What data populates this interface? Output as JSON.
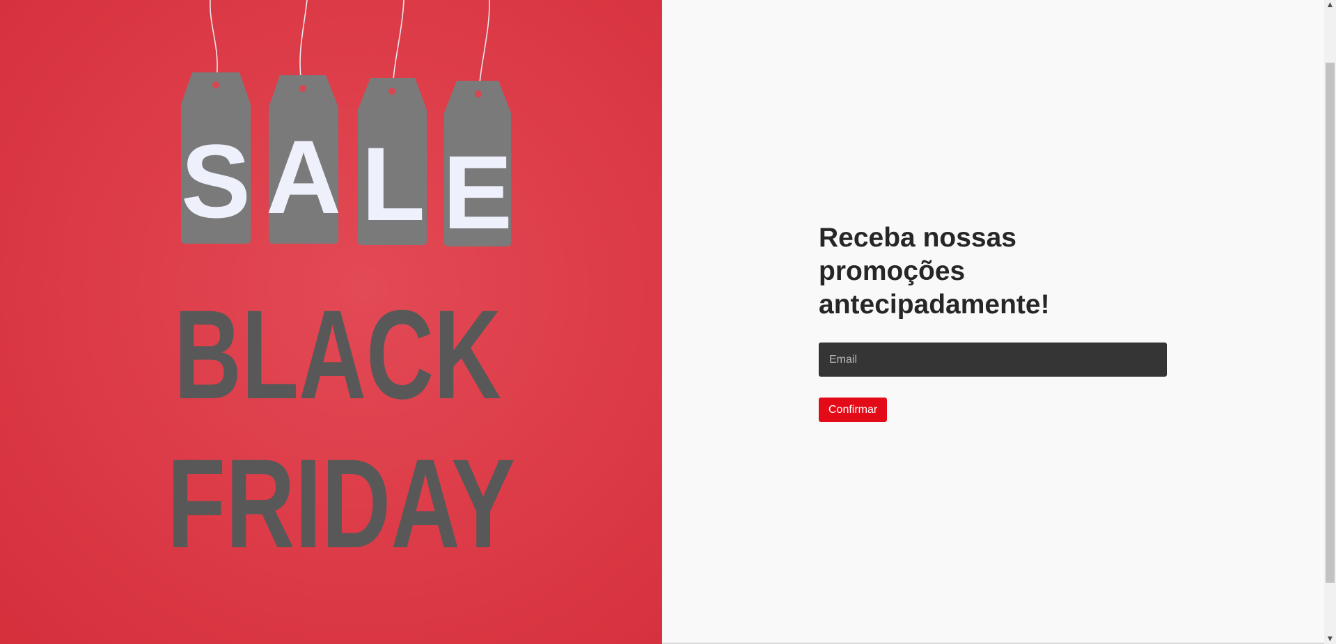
{
  "hero": {
    "tags": [
      "S",
      "A",
      "L",
      "E"
    ],
    "line1": "BLACK",
    "line2": "FRIDAY",
    "background_color": "#dd3d49",
    "tag_color": "#7a7a7b",
    "tag_letter_color": "#eef0fb",
    "word_color": "#585858"
  },
  "newsletter": {
    "headline_line1": "Receba nossas",
    "headline_line2": "promoções",
    "headline_line3": "antecipadamente!",
    "email_placeholder": "Email",
    "confirm_label": "Confirmar",
    "accent_color": "#e30b17"
  },
  "scrollbar": {
    "up_icon": "chevron-up-icon",
    "down_icon": "chevron-down-icon"
  }
}
